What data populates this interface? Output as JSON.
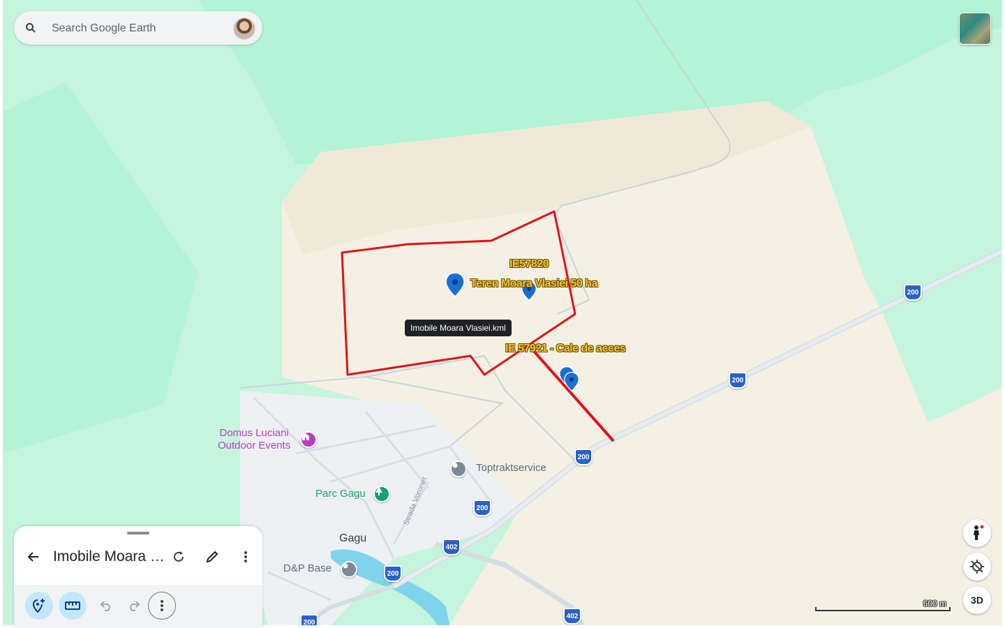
{
  "search": {
    "placeholder": "Search Google Earth"
  },
  "map": {
    "tooltip": "Imobile Moara Vlasiei.kml",
    "kml_labels": {
      "parcel_id": "IE57820",
      "parcel_name": "Teren Moara Vlasiei 50 ha",
      "access_road": "IE 57921 - Cale de acces"
    },
    "places": {
      "domus": "Domus Luciani\nOutdoor Events",
      "parc": "Parc Gagu",
      "toptrakt": "Toptraktservice",
      "gagu": "Gagu",
      "dp_base": "D&P Base"
    },
    "street": "Strada Voronet",
    "shields": {
      "s1": "200",
      "s2": "200",
      "s3": "200",
      "s4": "200",
      "s5": "402",
      "s6": "200",
      "s7": "402",
      "s8": "200"
    },
    "scale": "600 m"
  },
  "controls": {
    "three_d": "3D"
  },
  "panel": {
    "title": "Imobile Moara Vlasiei"
  },
  "colors": {
    "boundary": "#e3101a",
    "pin": "#1a6fd6",
    "forest": "#c6f5de",
    "field": "#f4f0e4",
    "shield": "#2a62c4"
  }
}
